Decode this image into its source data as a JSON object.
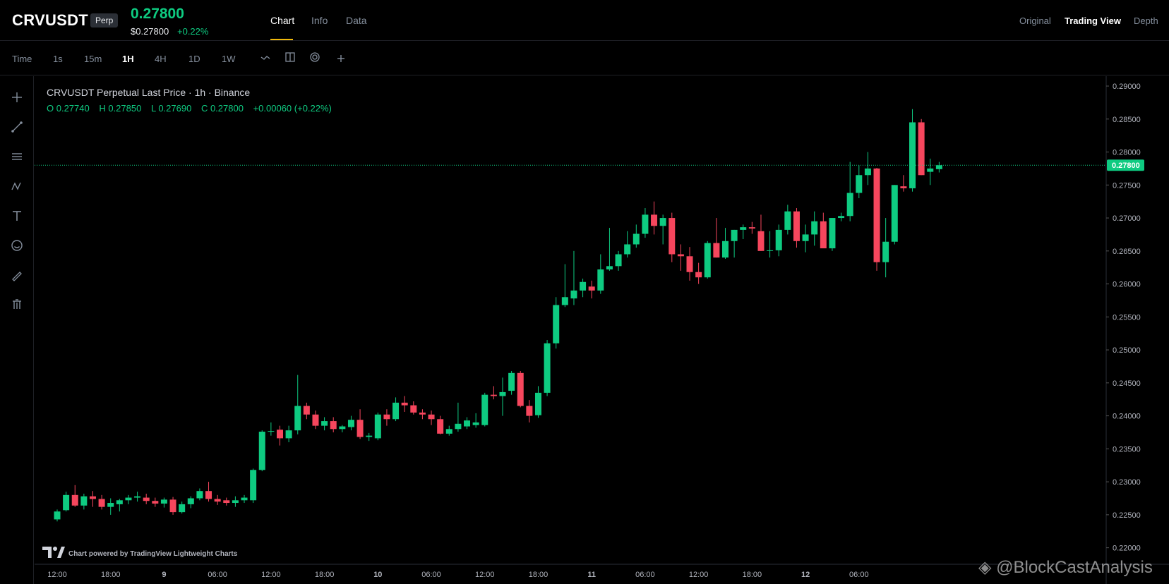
{
  "header": {
    "symbol": "CRVUSDT",
    "badge": "Perp",
    "last_price": "0.27800",
    "mark_price": "$0.27800",
    "change_pct": "+0.22%",
    "tabs": [
      {
        "label": "Chart"
      },
      {
        "label": "Info"
      },
      {
        "label": "Data"
      }
    ],
    "view_tabs": [
      {
        "label": "Original"
      },
      {
        "label": "Trading View"
      },
      {
        "label": "Depth"
      }
    ]
  },
  "toolbar": {
    "timeframes": [
      {
        "label": "Time"
      },
      {
        "label": "1s"
      },
      {
        "label": "15m"
      },
      {
        "label": "1H"
      },
      {
        "label": "4H"
      },
      {
        "label": "1D"
      },
      {
        "label": "1W"
      }
    ]
  },
  "legend": {
    "title": "CRVUSDT Perpetual Last Price · 1h · Binance",
    "open": "O 0.27740",
    "high": "H 0.27850",
    "low": "L 0.27690",
    "close": "C 0.27800",
    "change": "+0.00060 (+0.22%)"
  },
  "footer": {
    "credit": "Chart powered by TradingView Lightweight Charts",
    "watermark": "◈ @BlockCastAnalysis"
  },
  "colors": {
    "up": "#0ecb81",
    "down": "#f6465d",
    "accent": "#f0b90b"
  },
  "chart_data": {
    "type": "candlestick",
    "ylim": [
      0.2175,
      0.2915
    ],
    "y_ticks": [
      "0.22000",
      "0.22500",
      "0.23000",
      "0.23500",
      "0.24000",
      "0.24500",
      "0.25000",
      "0.25500",
      "0.26000",
      "0.26500",
      "0.27000",
      "0.27500",
      "0.28000",
      "0.28500",
      "0.29000"
    ],
    "x_ticks": [
      {
        "label": "12:00",
        "index": 0
      },
      {
        "label": "18:00",
        "index": 6
      },
      {
        "label": "9",
        "index": 12
      },
      {
        "label": "06:00",
        "index": 18
      },
      {
        "label": "12:00",
        "index": 24
      },
      {
        "label": "18:00",
        "index": 30
      },
      {
        "label": "10",
        "index": 36
      },
      {
        "label": "06:00",
        "index": 42
      },
      {
        "label": "12:00",
        "index": 48
      },
      {
        "label": "18:00",
        "index": 54
      },
      {
        "label": "11",
        "index": 60
      },
      {
        "label": "06:00",
        "index": 66
      },
      {
        "label": "12:00",
        "index": 72
      },
      {
        "label": "18:00",
        "index": 78
      },
      {
        "label": "12",
        "index": 84
      },
      {
        "label": "06:00",
        "index": 90
      }
    ],
    "last_price": 0.278,
    "last_price_label": "0.27800",
    "candles": [
      [
        0.2243,
        0.2258,
        0.224,
        0.2255
      ],
      [
        0.2257,
        0.2285,
        0.2255,
        0.228
      ],
      [
        0.228,
        0.2295,
        0.2262,
        0.2264
      ],
      [
        0.2264,
        0.2282,
        0.2258,
        0.2278
      ],
      [
        0.2278,
        0.2286,
        0.2262,
        0.2274
      ],
      [
        0.2274,
        0.228,
        0.2258,
        0.2262
      ],
      [
        0.2262,
        0.2275,
        0.225,
        0.2268
      ],
      [
        0.2266,
        0.2274,
        0.2255,
        0.2272
      ],
      [
        0.2272,
        0.228,
        0.2266,
        0.2276
      ],
      [
        0.2276,
        0.2285,
        0.227,
        0.2278
      ],
      [
        0.2276,
        0.2282,
        0.2266,
        0.2271
      ],
      [
        0.2271,
        0.2276,
        0.2262,
        0.2267
      ],
      [
        0.2267,
        0.2276,
        0.2261,
        0.2273
      ],
      [
        0.2273,
        0.2277,
        0.225,
        0.2254
      ],
      [
        0.2254,
        0.227,
        0.2252,
        0.2266
      ],
      [
        0.2266,
        0.2278,
        0.226,
        0.2275
      ],
      [
        0.2275,
        0.229,
        0.2272,
        0.2286
      ],
      [
        0.2286,
        0.23,
        0.227,
        0.2274
      ],
      [
        0.2274,
        0.228,
        0.2265,
        0.227
      ],
      [
        0.2272,
        0.2276,
        0.2264,
        0.2268
      ],
      [
        0.2268,
        0.2278,
        0.2262,
        0.2272
      ],
      [
        0.2272,
        0.228,
        0.2268,
        0.2276
      ],
      [
        0.2272,
        0.232,
        0.2268,
        0.2318
      ],
      [
        0.2318,
        0.2378,
        0.2316,
        0.2376
      ],
      [
        0.2376,
        0.239,
        0.237,
        0.2377
      ],
      [
        0.2379,
        0.2385,
        0.2355,
        0.2366
      ],
      [
        0.2366,
        0.2385,
        0.236,
        0.2378
      ],
      [
        0.2378,
        0.2462,
        0.2372,
        0.2415
      ],
      [
        0.2415,
        0.242,
        0.2395,
        0.2402
      ],
      [
        0.2402,
        0.2408,
        0.238,
        0.2385
      ],
      [
        0.2385,
        0.2398,
        0.2378,
        0.2392
      ],
      [
        0.2392,
        0.2398,
        0.2375,
        0.238
      ],
      [
        0.238,
        0.2386,
        0.2375,
        0.2384
      ],
      [
        0.2383,
        0.24,
        0.2378,
        0.2394
      ],
      [
        0.2394,
        0.241,
        0.2365,
        0.2368
      ],
      [
        0.2368,
        0.2374,
        0.2362,
        0.237
      ],
      [
        0.2366,
        0.2405,
        0.2363,
        0.2402
      ],
      [
        0.2402,
        0.241,
        0.2385,
        0.2395
      ],
      [
        0.2395,
        0.2428,
        0.2392,
        0.242
      ],
      [
        0.242,
        0.243,
        0.2406,
        0.2416
      ],
      [
        0.2416,
        0.2422,
        0.2402,
        0.2405
      ],
      [
        0.2405,
        0.241,
        0.2395,
        0.2402
      ],
      [
        0.2402,
        0.2408,
        0.2386,
        0.2395
      ],
      [
        0.2395,
        0.24,
        0.2372,
        0.2373
      ],
      [
        0.2373,
        0.2385,
        0.237,
        0.238
      ],
      [
        0.238,
        0.242,
        0.2376,
        0.2388
      ],
      [
        0.2384,
        0.2398,
        0.238,
        0.2393
      ],
      [
        0.2386,
        0.2404,
        0.2382,
        0.239
      ],
      [
        0.2386,
        0.2435,
        0.2384,
        0.2432
      ],
      [
        0.2432,
        0.2445,
        0.2425,
        0.243
      ],
      [
        0.243,
        0.2458,
        0.24,
        0.2436
      ],
      [
        0.2438,
        0.2468,
        0.2432,
        0.2465
      ],
      [
        0.2465,
        0.2468,
        0.2413,
        0.2415
      ],
      [
        0.2415,
        0.2424,
        0.239,
        0.24
      ],
      [
        0.2401,
        0.2445,
        0.2397,
        0.2435
      ],
      [
        0.2435,
        0.2515,
        0.243,
        0.251
      ],
      [
        0.251,
        0.258,
        0.2502,
        0.2568
      ],
      [
        0.2568,
        0.263,
        0.2565,
        0.258
      ],
      [
        0.2578,
        0.265,
        0.2568,
        0.259
      ],
      [
        0.259,
        0.2608,
        0.258,
        0.2603
      ],
      [
        0.2596,
        0.2605,
        0.2578,
        0.259
      ],
      [
        0.259,
        0.2645,
        0.2585,
        0.2622
      ],
      [
        0.2622,
        0.2685,
        0.262,
        0.2627
      ],
      [
        0.2627,
        0.265,
        0.262,
        0.2645
      ],
      [
        0.2645,
        0.268,
        0.264,
        0.266
      ],
      [
        0.266,
        0.269,
        0.2655,
        0.2676
      ],
      [
        0.2676,
        0.2715,
        0.267,
        0.2705
      ],
      [
        0.2705,
        0.2725,
        0.2675,
        0.2688
      ],
      [
        0.2688,
        0.2705,
        0.266,
        0.27
      ],
      [
        0.27,
        0.2708,
        0.2633,
        0.2645
      ],
      [
        0.2645,
        0.266,
        0.262,
        0.2642
      ],
      [
        0.2642,
        0.2656,
        0.2605,
        0.2618
      ],
      [
        0.2618,
        0.2632,
        0.26,
        0.261
      ],
      [
        0.261,
        0.2665,
        0.2608,
        0.2662
      ],
      [
        0.2662,
        0.27,
        0.264,
        0.264
      ],
      [
        0.264,
        0.2685,
        0.2638,
        0.2665
      ],
      [
        0.2665,
        0.2682,
        0.264,
        0.2682
      ],
      [
        0.2682,
        0.269,
        0.2668,
        0.2686
      ],
      [
        0.2686,
        0.2694,
        0.2676,
        0.2684
      ],
      [
        0.268,
        0.2705,
        0.265,
        0.265
      ],
      [
        0.265,
        0.268,
        0.264,
        0.2651
      ],
      [
        0.2651,
        0.269,
        0.2642,
        0.2682
      ],
      [
        0.2682,
        0.272,
        0.2675,
        0.271
      ],
      [
        0.271,
        0.2715,
        0.2655,
        0.2665
      ],
      [
        0.2665,
        0.269,
        0.2648,
        0.2675
      ],
      [
        0.2675,
        0.271,
        0.2658,
        0.2695
      ],
      [
        0.2695,
        0.2708,
        0.2655,
        0.2654
      ],
      [
        0.2654,
        0.27,
        0.265,
        0.27
      ],
      [
        0.27,
        0.2708,
        0.2695,
        0.2703
      ],
      [
        0.2703,
        0.2785,
        0.2695,
        0.2738
      ],
      [
        0.2738,
        0.278,
        0.273,
        0.2765
      ],
      [
        0.2765,
        0.28,
        0.275,
        0.2775
      ],
      [
        0.2775,
        0.2776,
        0.262,
        0.2633
      ],
      [
        0.2633,
        0.27,
        0.261,
        0.2664
      ],
      [
        0.2664,
        0.275,
        0.266,
        0.275
      ],
      [
        0.2748,
        0.2765,
        0.274,
        0.2745
      ],
      [
        0.2745,
        0.2865,
        0.274,
        0.2845
      ],
      [
        0.2845,
        0.285,
        0.2765,
        0.2765
      ],
      [
        0.277,
        0.279,
        0.275,
        0.2775
      ],
      [
        0.2774,
        0.2785,
        0.2769,
        0.278
      ]
    ]
  }
}
